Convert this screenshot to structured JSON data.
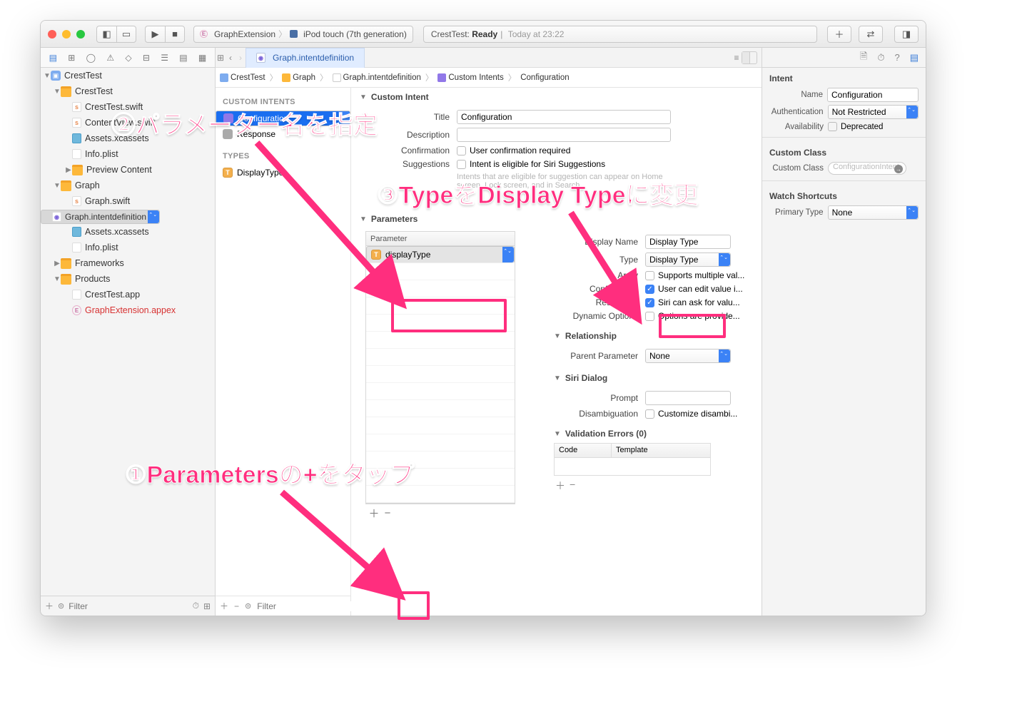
{
  "toolbar": {
    "scheme": "GraphExtension",
    "device": "iPod touch (7th generation)",
    "status_project": "CrestTest:",
    "status_state": "Ready",
    "status_time": "Today at 23:22"
  },
  "tab": {
    "file": "Graph.intentdefinition"
  },
  "crumbs": [
    "CrestTest",
    "Graph",
    "Graph.intentdefinition",
    "Custom Intents",
    "Configuration"
  ],
  "navigator": {
    "root": "CrestTest",
    "items": [
      {
        "t": "folder",
        "l": "CrestTest"
      },
      {
        "t": "swift",
        "l": "CrestTest.swift"
      },
      {
        "t": "swift",
        "l": "ContentView.swift"
      },
      {
        "t": "asset",
        "l": "Assets.xcassets"
      },
      {
        "t": "plist",
        "l": "Info.plist"
      },
      {
        "t": "folder",
        "l": "Preview Content",
        "closed": true
      },
      {
        "t": "folder",
        "l": "Graph"
      },
      {
        "t": "swift",
        "l": "Graph.swift"
      },
      {
        "t": "idef",
        "l": "Graph.intentdefinition",
        "sel": true
      },
      {
        "t": "asset",
        "l": "Assets.xcassets"
      },
      {
        "t": "plist",
        "l": "Info.plist"
      },
      {
        "t": "folder",
        "l": "Frameworks",
        "closed": true
      },
      {
        "t": "folder",
        "l": "Products"
      },
      {
        "t": "app",
        "l": "CrestTest.app"
      },
      {
        "t": "appex",
        "l": "GraphExtension.appex",
        "red": true
      }
    ],
    "filter_placeholder": "Filter"
  },
  "intentlist": {
    "h1": "CUSTOM INTENTS",
    "i1": "Configuration",
    "i2": "Response",
    "h2": "TYPES",
    "t1": "DisplayType",
    "filter_placeholder": "Filter"
  },
  "editor": {
    "sec_custom": "Custom Intent",
    "title_lbl": "Title",
    "title_val": "Configuration",
    "desc_lbl": "Description",
    "conf_lbl": "Confirmation",
    "conf_chk": "User confirmation required",
    "sugg_lbl": "Suggestions",
    "sugg_chk": "Intent is eligible for Siri Suggestions",
    "sugg_hint": "Intents that are eligible for suggestion can appear on Home screen, Lock screen, and in Search.",
    "sec_params": "Parameters",
    "ptable_hdr": "Parameter",
    "pname": "displayType",
    "dn_lbl": "Display Name",
    "dn_val": "Display Type",
    "type_lbl": "Type",
    "type_val": "Display Type",
    "arr_lbl": "Array",
    "arr_chk": "Supports multiple val...",
    "cfg_lbl": "Configurable",
    "cfg_chk": "User can edit value i...",
    "res_lbl": "Resolvable",
    "res_chk": "Siri can ask for valu...",
    "dyn_lbl": "Dynamic Options",
    "dyn_chk": "Options are provide...",
    "sec_rel": "Relationship",
    "pp_lbl": "Parent Parameter",
    "pp_val": "None",
    "sec_siri": "Siri Dialog",
    "prompt_lbl": "Prompt",
    "dis_lbl": "Disambiguation",
    "dis_chk": "Customize disambi...",
    "sec_val": "Validation Errors (0)",
    "vh1": "Code",
    "vh2": "Template"
  },
  "inspector": {
    "h1": "Intent",
    "name_lbl": "Name",
    "name_val": "Configuration",
    "auth_lbl": "Authentication",
    "auth_val": "Not Restricted",
    "avail_lbl": "Availability",
    "avail_chk": "Deprecated",
    "h2": "Custom Class",
    "cc_lbl": "Custom Class",
    "cc_ph": "ConfigurationIntent",
    "h3": "Watch Shortcuts",
    "pt_lbl": "Primary Type",
    "pt_val": "None"
  },
  "annotations": {
    "a1": "①Parametersの+をタップ",
    "a2": "②パラメーター名を指定",
    "a3": "③TypeをDisplay Typeに変更"
  }
}
